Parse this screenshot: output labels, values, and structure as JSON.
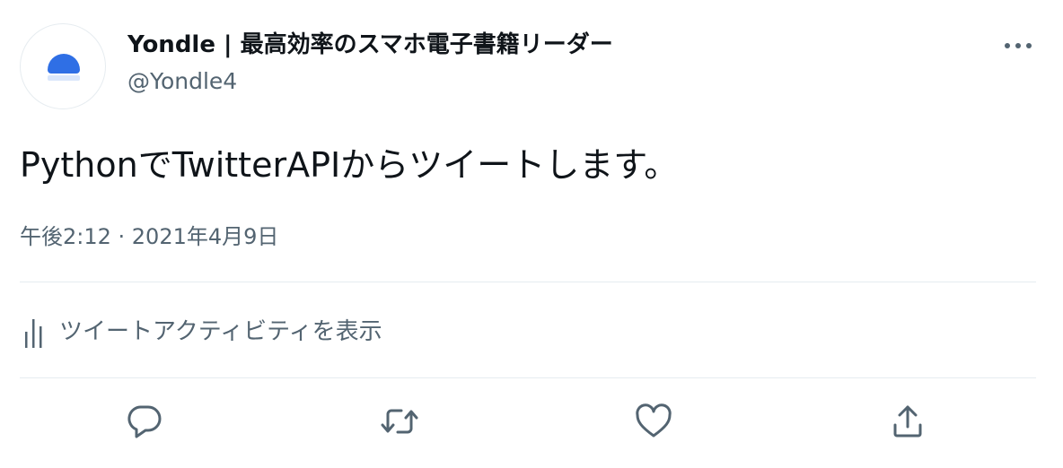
{
  "author": {
    "display_name": "Yondle | 最高効率のスマホ電子書籍リーダー",
    "handle": "@Yondle4",
    "avatar_icon": "yondle-logo-icon"
  },
  "tweet": {
    "text": "PythonでTwitterAPIからツイートします。",
    "timestamp": "午後2:12 · 2021年4月9日"
  },
  "activity": {
    "label": "ツイートアクティビティを表示",
    "icon": "bar-chart-icon"
  },
  "actions": {
    "reply_icon": "reply-icon",
    "retweet_icon": "retweet-icon",
    "like_icon": "heart-icon",
    "share_icon": "share-icon"
  },
  "colors": {
    "text_primary": "#0f1419",
    "text_secondary": "#536471",
    "divider": "#e6ecf0",
    "brand": "#2f6fe5"
  }
}
